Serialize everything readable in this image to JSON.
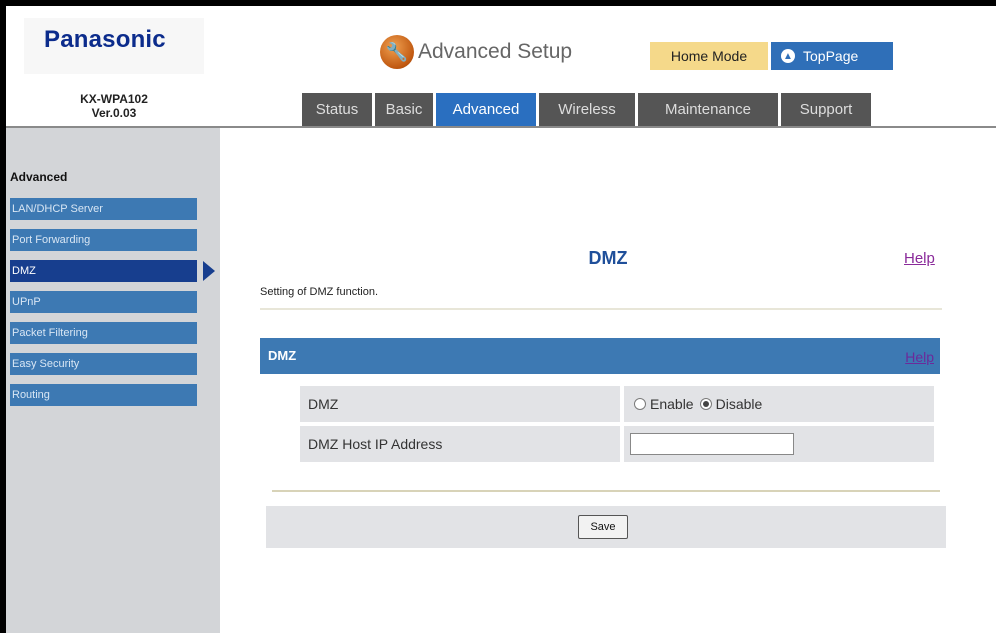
{
  "header": {
    "logo": "Panasonic",
    "model": "KX-WPA102",
    "version": "Ver.0.03",
    "page_title": "Advanced Setup",
    "home_mode": "Home Mode",
    "toppage": "TopPage",
    "tabs": [
      {
        "label": "Status"
      },
      {
        "label": "Basic"
      },
      {
        "label": "Advanced"
      },
      {
        "label": "Wireless"
      },
      {
        "label": "Maintenance"
      },
      {
        "label": "Support"
      }
    ]
  },
  "sidebar": {
    "heading": "Advanced",
    "items": [
      {
        "label": "LAN/DHCP Server"
      },
      {
        "label": "Port Forwarding"
      },
      {
        "label": "DMZ"
      },
      {
        "label": "UPnP"
      },
      {
        "label": "Packet Filtering"
      },
      {
        "label": "Easy Security"
      },
      {
        "label": "Routing"
      }
    ]
  },
  "main": {
    "title": "DMZ",
    "help": "Help",
    "description": "Setting of DMZ function.",
    "section": {
      "title": "DMZ",
      "help": "Help"
    },
    "rows": {
      "dmz_label": "DMZ",
      "enable_label": "Enable",
      "disable_label": "Disable",
      "selected": "Disable",
      "host_label": "DMZ Host IP Address",
      "host_value": ""
    },
    "save_label": "Save"
  },
  "colors": {
    "active_tab": "#2a6fc0",
    "sidebar_item": "#3d79b3",
    "sidebar_active": "#173e8e",
    "home_mode_bg": "#f5d98a",
    "toppage_bg": "#2f6fb8"
  }
}
